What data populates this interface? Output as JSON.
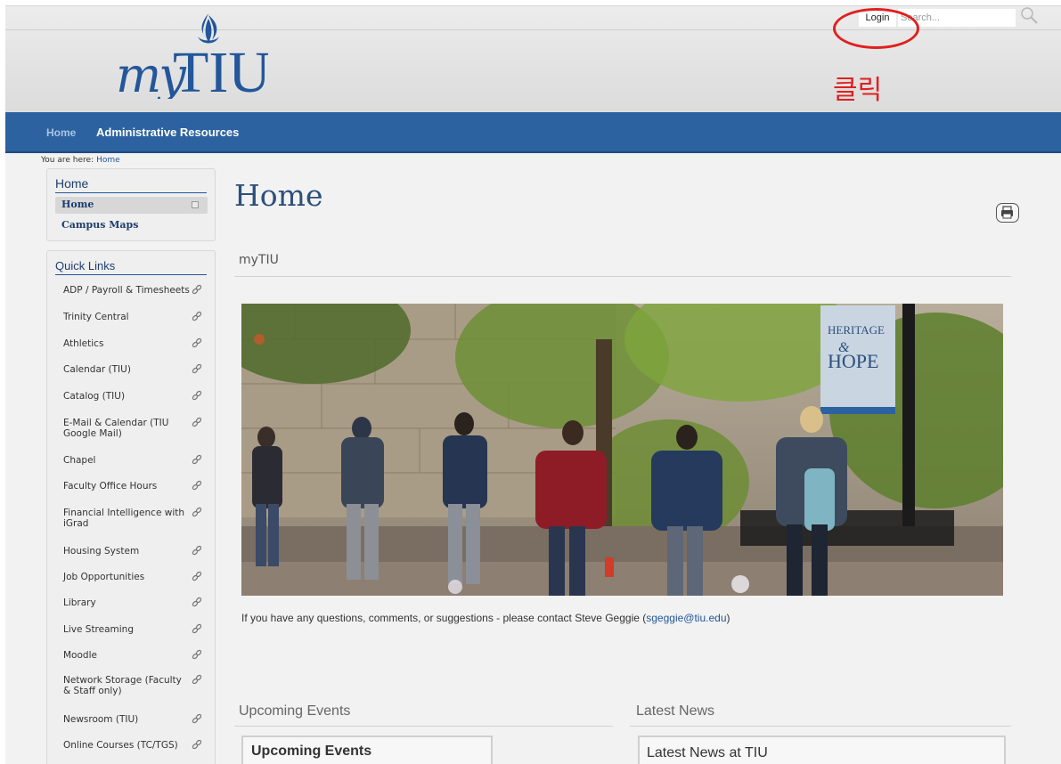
{
  "header": {
    "logo_alt": "myTIU",
    "login_label": "Login",
    "search_placeholder": "Search...",
    "annotation": "클릭"
  },
  "nav": {
    "home": "Home",
    "admin": "Administrative Resources"
  },
  "breadcrumb": {
    "prefix": "You are here:",
    "current": "Home"
  },
  "sidebar": {
    "title": "Home",
    "items": [
      {
        "label": "Home"
      },
      {
        "label": "Campus Maps"
      }
    ]
  },
  "quick_links": {
    "title": "Quick Links",
    "items": [
      {
        "label": "ADP / Payroll & Timesheets"
      },
      {
        "label": "Trinity Central"
      },
      {
        "label": "Athletics"
      },
      {
        "label": "Calendar (TIU)"
      },
      {
        "label": "Catalog (TIU)"
      },
      {
        "label": "E-Mail & Calendar (TIU Google Mail)"
      },
      {
        "label": "Chapel"
      },
      {
        "label": "Faculty Office Hours"
      },
      {
        "label": "Financial Intelligence with iGrad"
      },
      {
        "label": "Housing System"
      },
      {
        "label": "Job Opportunities"
      },
      {
        "label": "Library"
      },
      {
        "label": "Live Streaming"
      },
      {
        "label": "Moodle"
      },
      {
        "label": "Network Storage (Faculty & Staff only)"
      },
      {
        "label": "Newsroom (TIU)"
      },
      {
        "label": "Online Courses (TC/TGS)"
      }
    ]
  },
  "main": {
    "title": "Home",
    "section_title": "myTIU",
    "contact_text": "If you have any questions, comments, or suggestions - please contact Steve Geggie (",
    "contact_email": "sgeggie@tiu.edu",
    "contact_close": ")",
    "banner_line1": "HERITAGE",
    "banner_amp": "&",
    "banner_line2": "HOPE"
  },
  "events": {
    "heading": "Upcoming Events",
    "box_title": "Upcoming Events"
  },
  "news": {
    "heading": "Latest News",
    "box_title": "Latest News at TIU"
  },
  "colors": {
    "nav_blue": "#2d62a0",
    "brand_blue": "#23569a",
    "annotation_red": "#e02020"
  }
}
